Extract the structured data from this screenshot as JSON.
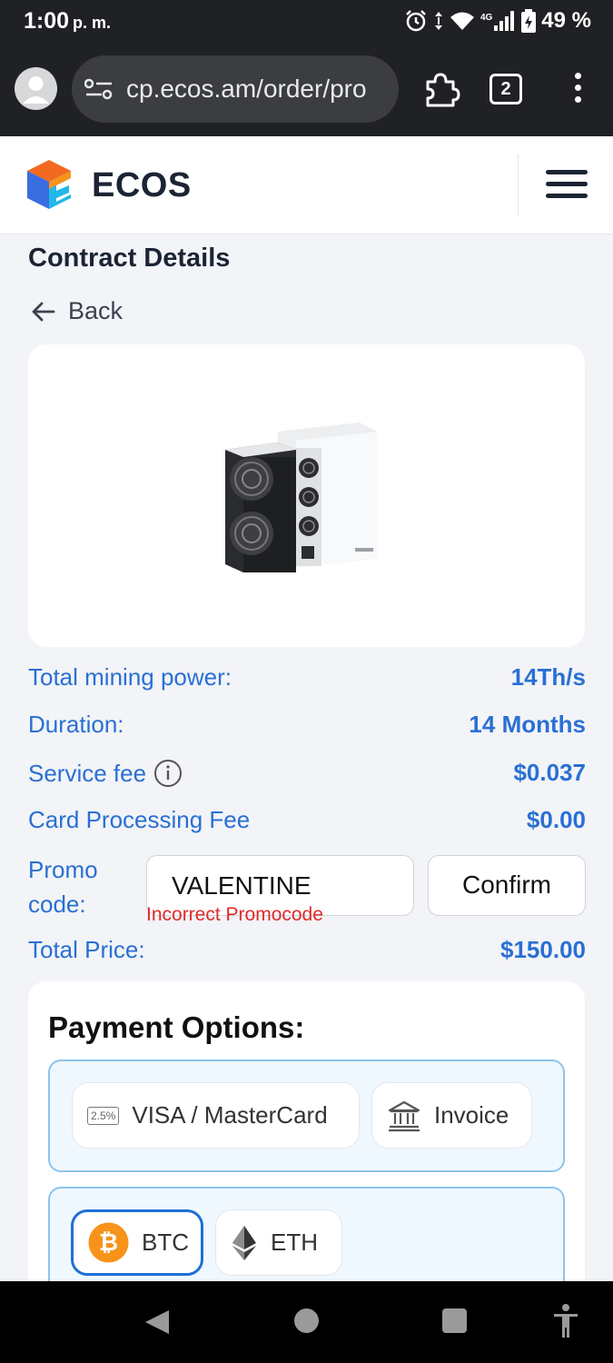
{
  "status_bar": {
    "time": "1:00",
    "time_suffix": "p. m.",
    "network": "4G",
    "battery": "49 %"
  },
  "browser": {
    "url": "cp.ecos.am/order/pro",
    "tab_count": "2"
  },
  "header": {
    "brand": "ECOS"
  },
  "page": {
    "title": "Contract Details",
    "back_label": "Back"
  },
  "details": {
    "mining_power_label": "Total mining power:",
    "mining_power_value": "14Th/s",
    "duration_label": "Duration:",
    "duration_value": "14 Months",
    "service_fee_label": "Service fee",
    "service_fee_value": "$0.037",
    "card_fee_label": "Card Processing Fee",
    "card_fee_value": "$0.00",
    "promo_label_line1": "Promo",
    "promo_label_line2": "code:",
    "promo_value": "VALENTINE",
    "promo_error": "Incorrect Promocode",
    "confirm_label": "Confirm",
    "total_label": "Total Price:",
    "total_value": "$150.00"
  },
  "payment": {
    "title": "Payment Options:",
    "card_badge": "2.5%",
    "card_label": "VISA / MasterCard",
    "invoice_label": "Invoice",
    "btc_label": "BTC",
    "eth_label": "ETH",
    "selected": "BTC"
  },
  "colors": {
    "accent_blue": "#2a6fd4",
    "error_red": "#e02a2a",
    "selected_border": "#1d6fd6",
    "btc_orange": "#f7931a"
  },
  "icons": [
    "alarm-icon",
    "vibrate-icon",
    "wifi-icon",
    "signal-icon",
    "battery-icon",
    "tune-icon",
    "extension-icon",
    "tabs-icon",
    "more-vert-icon",
    "hamburger-menu-icon",
    "arrow-left-icon",
    "info-icon",
    "bank-icon",
    "bitcoin-icon",
    "ethereum-icon",
    "nav-back-icon",
    "nav-home-icon",
    "nav-recent-icon",
    "accessibility-icon"
  ]
}
